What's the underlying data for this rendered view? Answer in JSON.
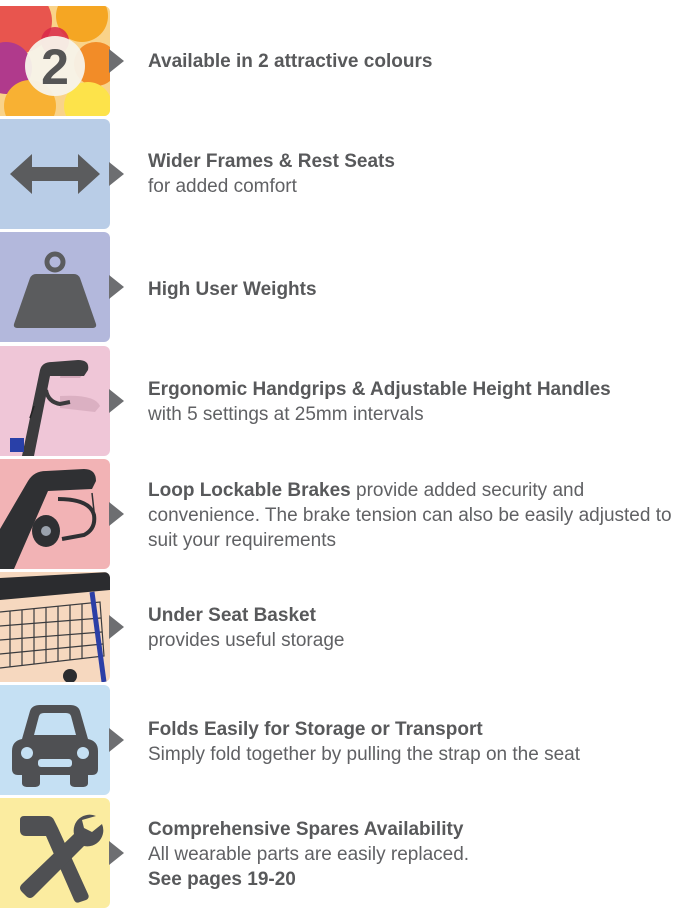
{
  "features": [
    {
      "title": "Available in 2 attractive colours",
      "subtitle": "",
      "tile_color": "#f9d38a",
      "icon": "colour-number-icon",
      "icon_label": "2"
    },
    {
      "title": "Wider Frames & Rest Seats",
      "subtitle": "for added comfort",
      "tile_color": "#b9cde7",
      "icon": "double-arrow-icon"
    },
    {
      "title": "High User Weights",
      "subtitle": "",
      "tile_color": "#b3b8dc",
      "icon": "weight-icon"
    },
    {
      "title": "Ergonomic Handgrips & Adjustable Height Handles",
      "subtitle": "with 5 settings at 25mm intervals",
      "tile_color": "#efc6d7",
      "icon": "handgrip-photo-icon"
    },
    {
      "title": "Loop Lockable Brakes",
      "title_rest": " provide added security and convenience. The brake tension can also be easily adjusted to suit your requirements",
      "tile_color": "#f2b3b5",
      "icon": "brake-photo-icon"
    },
    {
      "title": "Under Seat Basket",
      "subtitle": "provides useful storage",
      "tile_color": "#f6d8bf",
      "icon": "basket-photo-icon"
    },
    {
      "title": "Folds Easily for Storage or Transport",
      "subtitle": "Simply fold together by pulling the strap on the seat",
      "tile_color": "#c5e0f3",
      "icon": "car-icon"
    },
    {
      "title": "Comprehensive Spares Availability",
      "subtitle": "All wearable parts are easily replaced.",
      "link": "See pages 19-20",
      "tile_color": "#fbeca0",
      "icon": "tools-icon"
    }
  ]
}
